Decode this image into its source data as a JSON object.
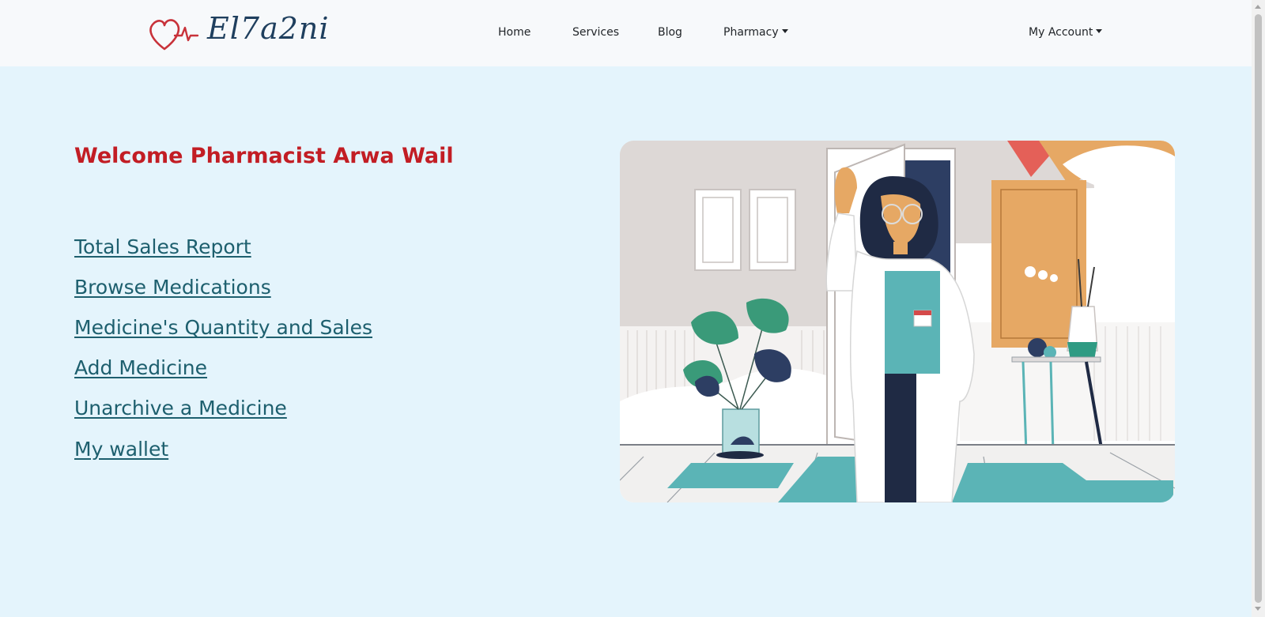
{
  "brand": {
    "logo_text": "El7a2ni"
  },
  "nav": {
    "home": "Home",
    "services": "Services",
    "blog": "Blog",
    "pharmacy": "Pharmacy",
    "account": "My Account"
  },
  "main": {
    "welcome": "Welcome Pharmacist Arwa Wail",
    "links": [
      "Total Sales Report",
      "Browse Medications",
      "Medicine's Quantity and Sales",
      "Add Medicine",
      "Unarchive a Medicine",
      "My wallet"
    ]
  },
  "illustration": {
    "name": "pharmacist-illustration"
  },
  "colors": {
    "background": "#e4f4fc",
    "navbar": "#f7f9fb",
    "welcome": "#c21d24",
    "links": "#1d5f6e",
    "logo_heart": "#c8323a",
    "logo_text": "#1f3f5e"
  }
}
